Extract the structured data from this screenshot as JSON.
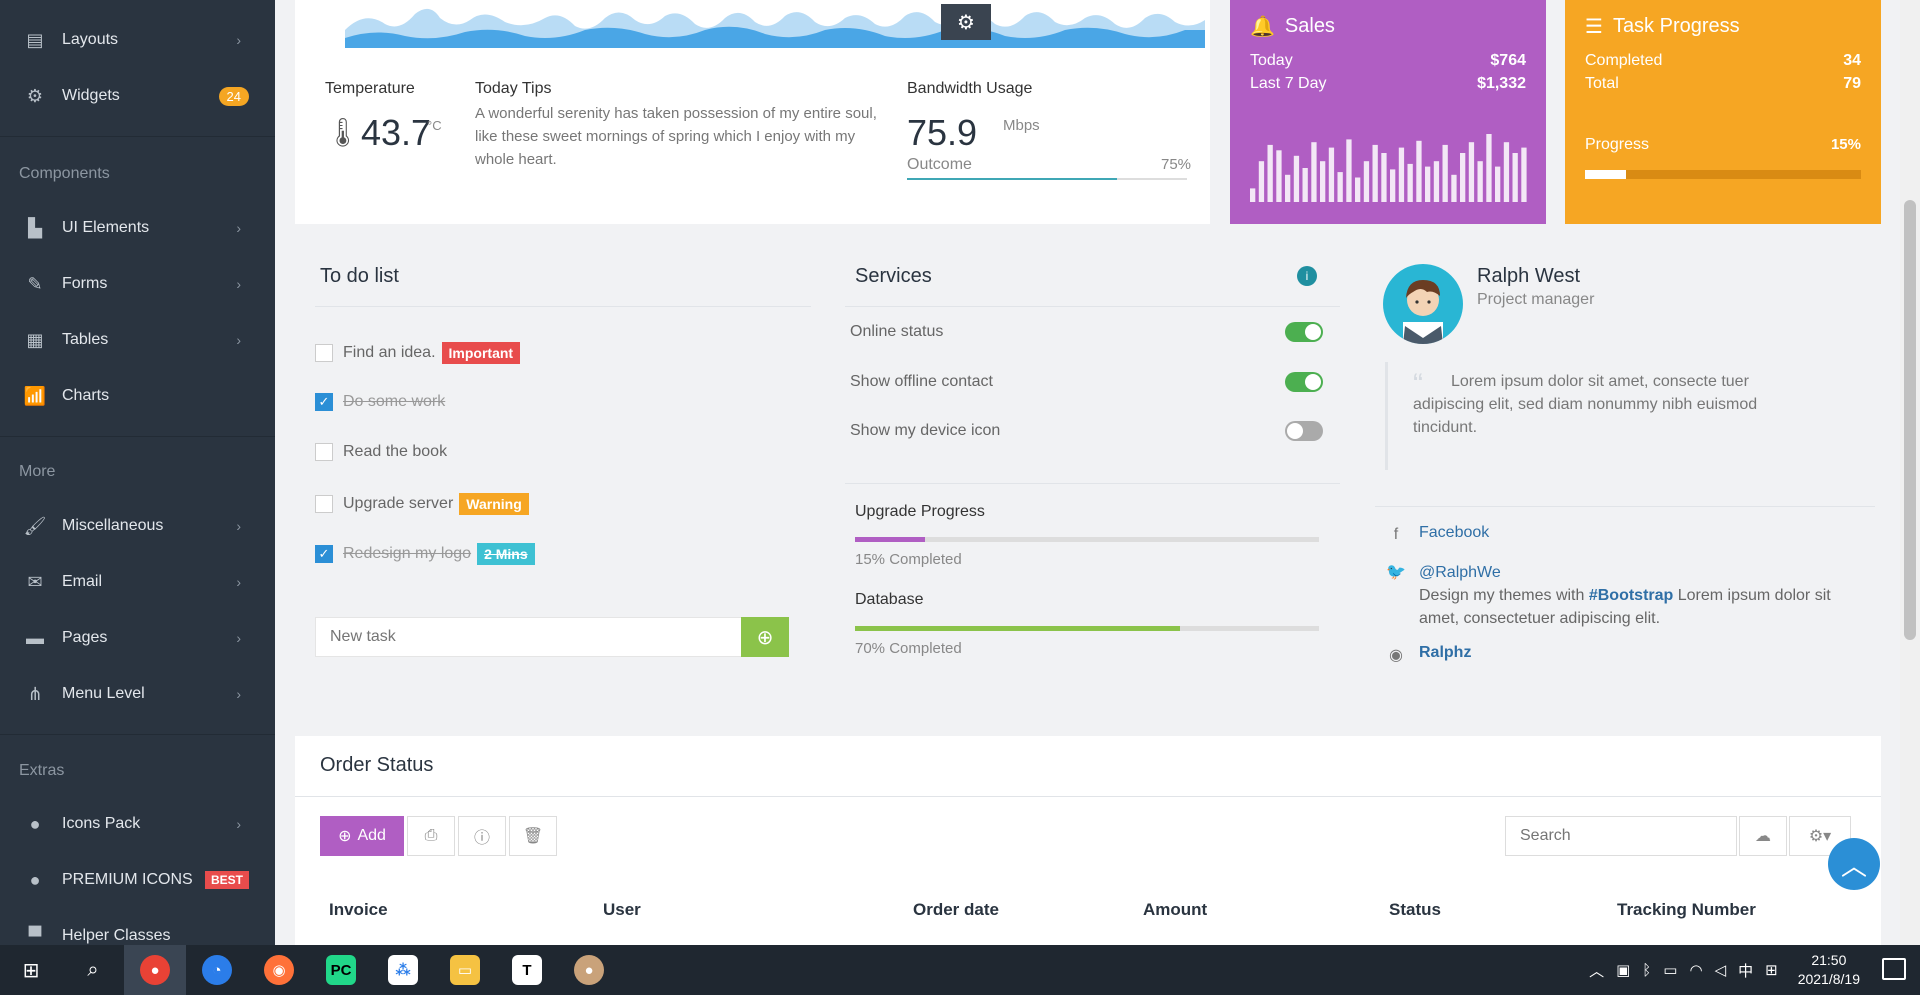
{
  "sidebar": {
    "items_top": [
      {
        "label": "Layouts",
        "icon": "layout-icon"
      },
      {
        "label": "Widgets",
        "icon": "widgets-icon",
        "badge": "24"
      }
    ],
    "section_components": "Components",
    "components": [
      {
        "label": "UI Elements"
      },
      {
        "label": "Forms"
      },
      {
        "label": "Tables"
      },
      {
        "label": "Charts"
      }
    ],
    "section_more": "More",
    "more": [
      {
        "label": "Miscellaneous"
      },
      {
        "label": "Email"
      },
      {
        "label": "Pages"
      },
      {
        "label": "Menu Level"
      }
    ],
    "section_extras": "Extras",
    "extras": [
      {
        "label": "Icons Pack"
      },
      {
        "label": "PREMIUM ICONS",
        "badge": "BEST"
      },
      {
        "label": "Helper Classes"
      }
    ]
  },
  "weather": {
    "temperature_label": "Temperature",
    "temperature_value": "43.7",
    "temperature_unit": "°C",
    "tips_label": "Today Tips",
    "tips_text": "A wonderful serenity has taken possession of my entire soul, like these sweet mornings of spring which I enjoy with my whole heart.",
    "bandwidth_label": "Bandwidth Usage",
    "bandwidth_value": "75.9",
    "bandwidth_unit": "Mbps",
    "outcome_label": "Outcome",
    "outcome_pct_text": "75%",
    "outcome_fraction": 0.75
  },
  "sales": {
    "title": "Sales",
    "today_label": "Today",
    "today_value": "$764",
    "last7_label": "Last 7 Day",
    "last7_value": "$1,332",
    "bars": [
      10,
      30,
      42,
      38,
      20,
      34,
      25,
      44,
      30,
      40,
      22,
      46,
      18,
      30,
      42,
      36,
      24,
      40,
      28,
      45,
      26,
      30,
      42,
      20,
      36,
      44,
      30,
      50,
      26,
      44,
      36,
      40
    ]
  },
  "task_progress": {
    "title": "Task Progress",
    "completed_label": "Completed",
    "completed_value": "34",
    "total_label": "Total",
    "total_value": "79",
    "progress_label": "Progress",
    "progress_text": "15%",
    "progress_fraction": 0.15
  },
  "todo": {
    "title": "To do list",
    "items": [
      {
        "text": "Find an idea.",
        "checked": false,
        "tag": "Important",
        "tag_color": "#e84c4c"
      },
      {
        "text": "Do some work",
        "checked": true,
        "tag": "",
        "tag_color": ""
      },
      {
        "text": "Read the book",
        "checked": false,
        "tag": "",
        "tag_color": ""
      },
      {
        "text": "Upgrade server",
        "checked": false,
        "tag": "Warning",
        "tag_color": "#f6a623"
      },
      {
        "text": "Redesign my logo",
        "checked": true,
        "tag": "2 Mins",
        "tag_color": "#3ec1d3"
      }
    ],
    "new_task_placeholder": "New task"
  },
  "services": {
    "title": "Services",
    "rows": [
      {
        "label": "Online status",
        "on": true
      },
      {
        "label": "Show offline contact",
        "on": true
      },
      {
        "label": "Show my device icon",
        "on": false
      }
    ],
    "upgrade_label": "Upgrade Progress",
    "upgrade_fraction": 0.15,
    "upgrade_note": "15% Completed",
    "database_label": "Database",
    "database_fraction": 0.7,
    "database_note": "70% Completed",
    "colors": {
      "upgrade": "#b05ec3",
      "database": "#8bc34a"
    }
  },
  "profile": {
    "name": "Ralph West",
    "role": "Project manager",
    "quote": "Lorem ipsum dolor sit amet, consecte tuer adipiscing elit, sed diam nonummy nibh euismod tincidunt.",
    "facebook": "Facebook",
    "twitter_handle": "@RalphWe",
    "twitter_text_1": "Design my themes with",
    "twitter_hashtag": "#Bootstrap",
    "twitter_text_2": "Lorem ipsum dolor sit amet, consectetuer adipiscing elit.",
    "instagram": "Ralphz"
  },
  "order_status": {
    "title": "Order Status",
    "add_label": "Add",
    "search_placeholder": "Search",
    "columns": [
      "Invoice",
      "User",
      "Order date",
      "Amount",
      "Status",
      "Tracking Number"
    ]
  },
  "taskbar": {
    "time": "21:50",
    "date": "2021/8/19",
    "ime": "中",
    "apps": [
      "chrome",
      "app-blue",
      "firefox",
      "pycharm",
      "app-dots",
      "file-explorer",
      "typora",
      "cat-app"
    ]
  }
}
